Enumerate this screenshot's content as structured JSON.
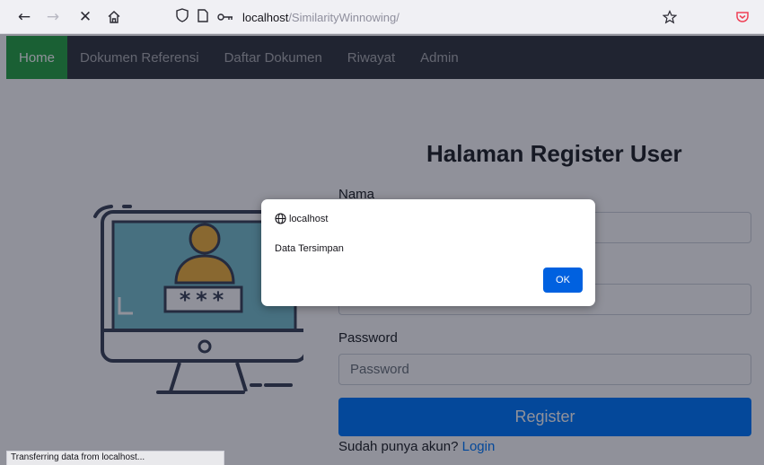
{
  "browser": {
    "url_host": "localhost",
    "url_path": "/SimilarityWinnowing/",
    "icons": {
      "back": "arrow-left-icon",
      "forward": "arrow-right-icon",
      "stop": "close-icon",
      "home": "home-icon",
      "tracking": "shield-icon",
      "page": "page-icon",
      "permissions": "key-icon",
      "bookmark": "star-icon",
      "pocket": "pocket-icon"
    },
    "status_text": "Transferring data from localhost..."
  },
  "navbar": {
    "items": [
      {
        "label": "Home",
        "active": true
      },
      {
        "label": "Dokumen Referensi",
        "active": false
      },
      {
        "label": "Daftar Dokumen",
        "active": false
      },
      {
        "label": "Riwayat",
        "active": false
      },
      {
        "label": "Admin",
        "active": false
      }
    ],
    "background": "#343a40",
    "active_color": "#28a745"
  },
  "illustration": {
    "icon": "computer-user-login-illustration",
    "password_mask": "***"
  },
  "form": {
    "title": "Halaman Register User",
    "nama_label": "Nama",
    "password_label": "Password",
    "password_placeholder": "Password",
    "register_label": "Register",
    "login_prompt": "Sudah punya akun?",
    "login_link": "Login",
    "button_color": "#007bff"
  },
  "dialog": {
    "origin": "localhost",
    "origin_icon": "globe-icon",
    "message": "Data Tersimpan",
    "ok_label": "OK",
    "ok_color": "#0061e0"
  }
}
